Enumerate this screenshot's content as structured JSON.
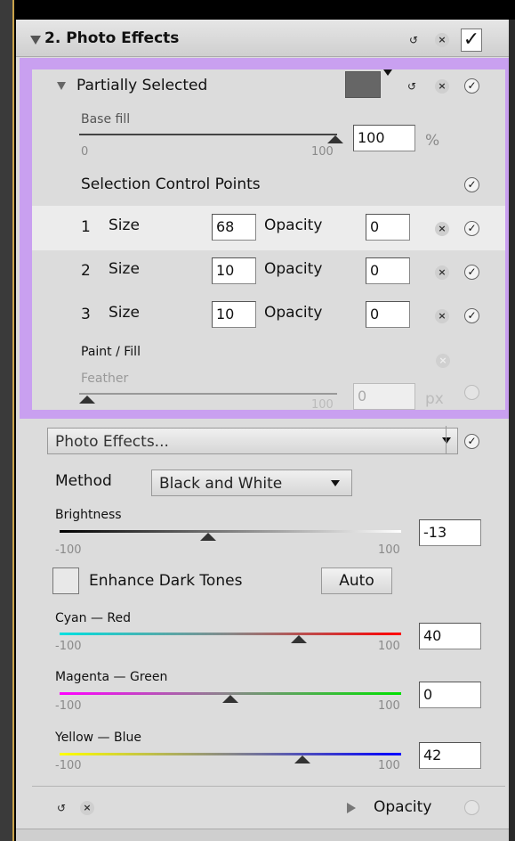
{
  "header": {
    "title": "2. Photo Effects"
  },
  "partial": {
    "title": "Partially Selected",
    "base_fill": {
      "label": "Base fill",
      "min": "0",
      "max": "100",
      "value": "100",
      "unit": "%",
      "level": 1.0
    },
    "scp_title": "Selection Control Points",
    "points": [
      {
        "index": "1",
        "size_label": "Size",
        "size": "68",
        "opacity_label": "Opacity",
        "opacity": "0"
      },
      {
        "index": "2",
        "size_label": "Size",
        "size": "10",
        "opacity_label": "Opacity",
        "opacity": "0"
      },
      {
        "index": "3",
        "size_label": "Size",
        "size": "10",
        "opacity_label": "Opacity",
        "opacity": "0"
      }
    ],
    "paint_fill": "Paint / Fill",
    "feather": {
      "label": "Feather",
      "max": "100",
      "value": "0",
      "unit": "px",
      "level": 0.0
    }
  },
  "effects": {
    "preset": "Photo Effects...",
    "method_label": "Method",
    "method_value": "Black and White",
    "brightness": {
      "label": "Brightness",
      "min": "-100",
      "max": "100",
      "value": "-13",
      "level": -13
    },
    "enhance_label": "Enhance Dark Tones",
    "auto_label": "Auto",
    "cyan_red": {
      "label": "Cyan — Red",
      "min": "-100",
      "max": "100",
      "value": "40",
      "level": 40
    },
    "magenta_green": {
      "label": "Magenta — Green",
      "min": "-100",
      "max": "100",
      "value": "0",
      "level": 0
    },
    "yellow_blue": {
      "label": "Yellow — Blue",
      "min": "-100",
      "max": "100",
      "value": "42",
      "level": 42
    },
    "opacity_label": "Opacity"
  },
  "colors": {
    "selection_border": "#c9a0f0",
    "panel_bg": "#dcdcdc",
    "cyan_red": [
      "#00e0e0",
      "#ff0000"
    ],
    "magenta_green": [
      "#ff00ff",
      "#00e000"
    ],
    "yellow_blue": [
      "#ffff00",
      "#0000ff"
    ]
  },
  "icons": [
    "collapse-triangle-icon",
    "undo-icon",
    "close-icon",
    "check-icon",
    "dropdown-arrow-icon",
    "expand-triangle-icon"
  ]
}
